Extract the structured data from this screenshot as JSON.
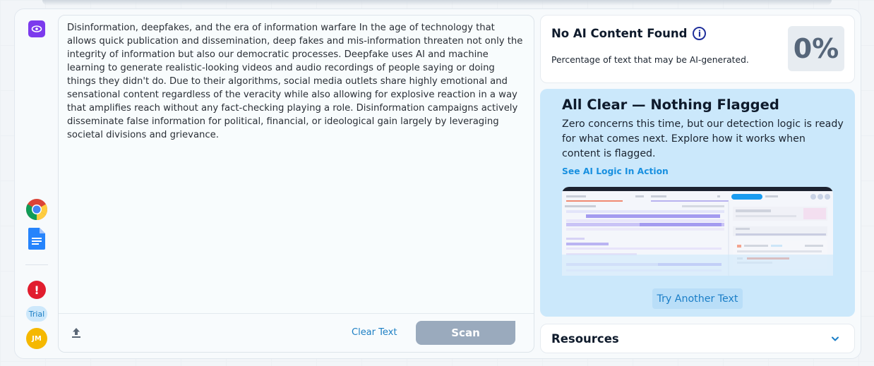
{
  "editor": {
    "text": "Disinformation, deepfakes, and the era of information warfare In the age of technology that allows quick publication and dissemination, deep fakes and mis-information threaten not only the integrity of information but also our democratic processes. Deepfake uses AI and machine learning to generate realistic-looking videos and audio recordings of people saying or doing things they didn't do. Due to their algorithms, social media outlets share highly emotional and sensational content regardless of the veracity while also allowing for explosive reaction in a way that amplifies reach without any fact-checking playing a role. Disinformation campaigns actively disseminate false information for political, financial, or ideological gain largely by leveraging societal divisions and grievance.",
    "clear_label": "Clear Text",
    "scan_label": "Scan"
  },
  "rail": {
    "trial_label": "Trial",
    "avatar_initials": "JM",
    "alert_glyph": "!"
  },
  "result": {
    "title": "No AI Content Found",
    "subtitle": "Percentage of text that may be AI-generated.",
    "percentage": "0%"
  },
  "all_clear": {
    "title": "All Clear — Nothing Flagged",
    "body": "Zero concerns this time, but our detection logic is ready for what comes next. Explore how it works when content is flagged.",
    "link_label": "See AI Logic In Action",
    "try_label": "Try Another Text"
  },
  "resources": {
    "title": "Resources"
  },
  "colors": {
    "accent_purple": "#7c3aed",
    "link_blue": "#1890e0",
    "alert_red": "#e11d2e",
    "avatar_yellow": "#f5b800",
    "scan_disabled": "#9aaabd",
    "clear_panel_bg": "#cbe8fb"
  },
  "icons": {
    "rail_top": "eye-icon",
    "browser": "chrome-icon",
    "docs": "google-docs-icon",
    "alert": "alert-icon",
    "upload": "upload-icon",
    "info": "info-icon",
    "expand": "chevron-down-icon"
  }
}
